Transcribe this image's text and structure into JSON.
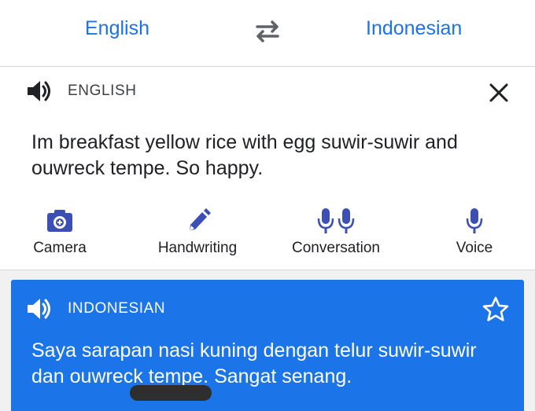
{
  "header": {
    "source_language": "English",
    "target_language": "Indonesian",
    "swap_icon": "swap-arrows-icon"
  },
  "input": {
    "label": "ENGLISH",
    "text": "Im breakfast yellow rice with egg suwir-suwir and ouwreck tempe. So happy.",
    "speaker_icon": "speaker-icon",
    "close_icon": "close-icon"
  },
  "tools": {
    "camera": "Camera",
    "handwriting": "Handwriting",
    "conversation": "Conversation",
    "voice": "Voice"
  },
  "output": {
    "label": "INDONESIAN",
    "text": "Saya sarapan nasi kuning dengan telur suwir-suwir dan ouwreck tempe.  Sangat senang.",
    "star_icon": "star-outline-icon"
  },
  "colors": {
    "accent": "#1a73e8",
    "tool_icon": "#3c4fb6",
    "output_card": "#1b74e8"
  }
}
